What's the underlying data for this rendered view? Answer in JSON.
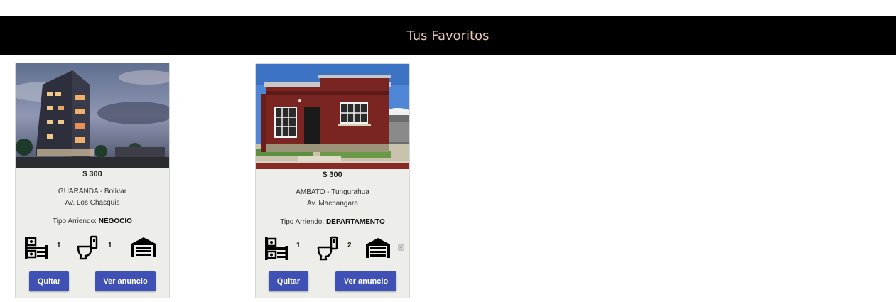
{
  "header": {
    "title": "Tus Favoritos",
    "background": "#000000",
    "text_color": "#e8c9b4"
  },
  "listings": [
    {
      "price": "$ 300",
      "city": "GUARANDA - Bolívar",
      "street": "Av. Los Chasquis",
      "tipo_label": "Tipo Arriendo:",
      "tipo_value": "NEGOCIO",
      "bedrooms": "1",
      "bathrooms": "1",
      "garage_checkbox": false,
      "remove_label": "Quitar",
      "view_label": "Ver anuncio"
    },
    {
      "price": "$ 300",
      "city": "AMBATO - Tungurahua",
      "street": "Av. Machangara",
      "tipo_label": "Tipo Arriendo:",
      "tipo_value": "DEPARTAMENTO",
      "bedrooms": "1",
      "bathrooms": "2",
      "garage_checkbox": true,
      "remove_label": "Quitar",
      "view_label": "Ver anuncio"
    }
  ],
  "colors": {
    "button": "#3f51b5",
    "card": "#edede9"
  },
  "icons": [
    "bed-icon",
    "toilet-icon",
    "garage-icon"
  ]
}
